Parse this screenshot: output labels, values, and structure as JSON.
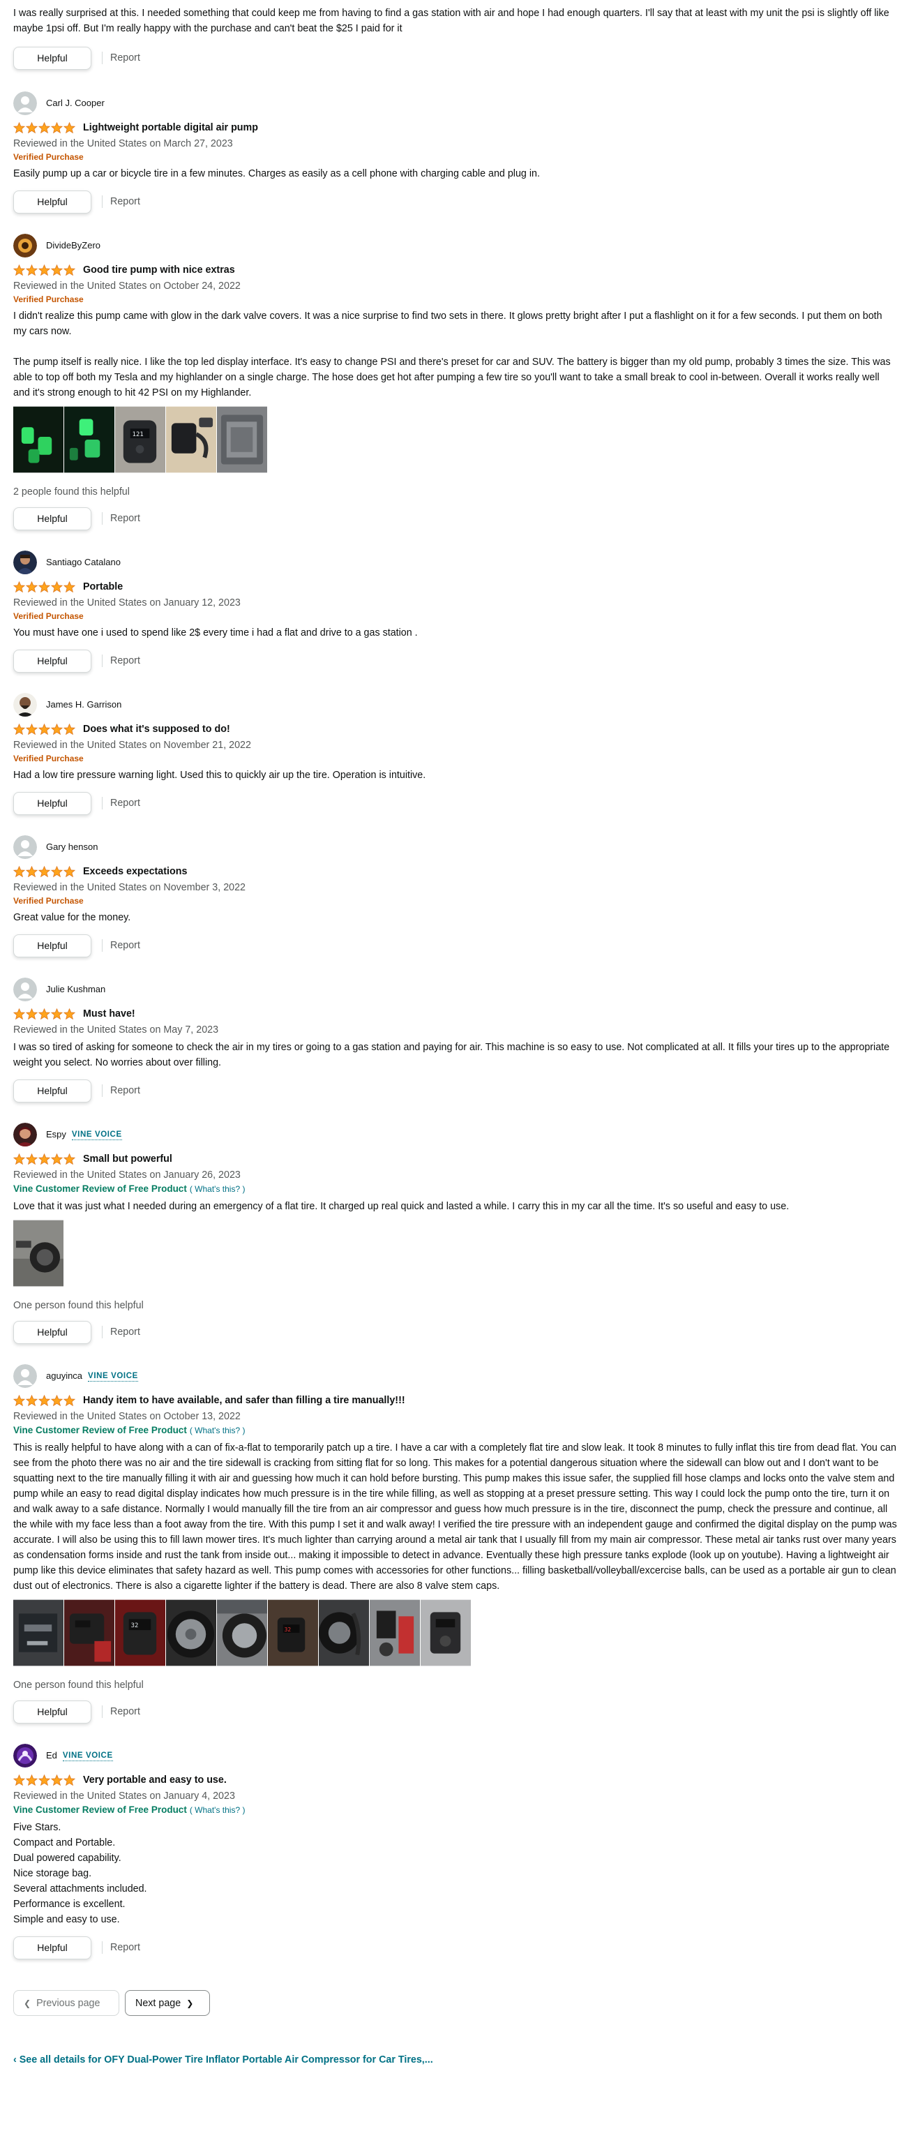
{
  "colors": {
    "star": "#ffa41c",
    "star_stroke": "#de7921",
    "verified": "#c45500",
    "vine_badge": "#067d62",
    "link": "#007185",
    "muted": "#565959"
  },
  "icons": {
    "star": "star-icon",
    "prev": "chevron-left-icon",
    "next": "chevron-right-icon",
    "see_all": "chevron-left-icon"
  },
  "labels": {
    "helpful": "Helpful",
    "report": "Report",
    "verified_purchase": "Verified Purchase",
    "vine_voice": "VINE VOICE",
    "vine_review": "Vine Customer Review of Free Product",
    "whats_this": "( What's this? )"
  },
  "top_review": {
    "text": "I was really surprised at this. I needed something that could keep me from having to find a gas station with air and hope I had enough quarters. I'll say that at least with my unit the psi is slightly off like maybe 1psi off. But I'm really happy with the purchase and can't beat the $25 I paid for it"
  },
  "reviews": [
    {
      "author": "Carl J. Cooper",
      "rating": 5,
      "title": "Lightweight portable digital air pump",
      "date": "Reviewed in the United States on March 27, 2023",
      "badge": "Verified Purchase",
      "text": "Easily pump up a car or bicycle tire in a few minutes. Charges as easily as a cell phone with charging cable and plug in."
    },
    {
      "author": "DivideByZero",
      "rating": 5,
      "title": "Good tire pump with nice extras",
      "date": "Reviewed in the United States on October 24, 2022",
      "badge": "Verified Purchase",
      "text": "I didn't realize this pump came with glow in the dark valve covers. It was a nice surprise to find two sets in there. It glows pretty bright after I put a flashlight on it for a few seconds. I put them on both my cars now.\n\nThe pump itself is really nice. I like the top led display interface. It's easy to change PSI and there's preset for car and SUV. The battery is bigger than my old pump, probably 3 times the size. This was able to top off both my Tesla and my highlander on a single charge. The hose does get hot after pumping a few tire so you'll want to take a small break to cool in-between. Overall it works really well and it's strong enough to hit 42 PSI on my Highlander.",
      "helpful_count": "2 people found this helpful"
    },
    {
      "author": "Santiago Catalano",
      "rating": 5,
      "title": "Portable",
      "date": "Reviewed in the United States on January 12, 2023",
      "badge": "Verified Purchase",
      "text": "You must have one i used to spend like 2$ every time i had a flat and drive to a gas station ."
    },
    {
      "author": "James H. Garrison",
      "rating": 5,
      "title": "Does what it's supposed to do!",
      "date": "Reviewed in the United States on November 21, 2022",
      "badge": "Verified Purchase",
      "text": "Had a low tire pressure warning light. Used this to quickly air up the tire. Operation is intuitive."
    },
    {
      "author": "Gary henson",
      "rating": 5,
      "title": "Exceeds expectations",
      "date": "Reviewed in the United States on November 3, 2022",
      "badge": "Verified Purchase",
      "text": "Great value for the money."
    },
    {
      "author": "Julie Kushman",
      "rating": 5,
      "title": "Must have!",
      "date": "Reviewed in the United States on May 7, 2023",
      "text": "I was so tired of asking for someone to check the air in my tires or going to a gas station and paying for air. This machine is so easy to use. Not complicated at all. It fills your tires up to the appropriate weight you select. No worries about over filling."
    },
    {
      "author": "Espy",
      "vine": true,
      "rating": 5,
      "title": "Small but powerful",
      "date": "Reviewed in the United States on January 26, 2023",
      "text": "Love that it was just what I needed during an emergency of a flat tire. It charged up real quick and lasted a while. I carry this in my car all the time. It's so useful and easy to use.",
      "helpful_count": "One person found this helpful"
    },
    {
      "author": "aguyinca",
      "vine": true,
      "rating": 5,
      "title": "Handy item to have available, and safer than filling a tire manually!!!",
      "date": "Reviewed in the United States on October 13, 2022",
      "text": "This is really helpful to have along with a can of fix-a-flat to temporarily patch up a tire. I have a car with a completely flat tire and slow leak. It took 8 minutes to fully inflat this tire from dead flat. You can see from the photo there was no air and the tire sidewall is cracking from sitting flat for so long. This makes for a potential dangerous situation where the sidewall can blow out and I don't want to be squatting next to the tire manually filling it with air and guessing how much it can hold before bursting. This pump makes this issue safer, the supplied fill hose clamps and locks onto the valve stem and pump while an easy to read digital display indicates how much pressure is in the tire while filling, as well as stopping at a preset pressure setting. This way I could lock the pump onto the tire, turn it on and walk away to a safe distance. Normally I would manually fill the tire from an air compressor and guess how much pressure is in the tire, disconnect the pump, check the pressure and continue, all the while with my face less than a foot away from the tire. With this pump I set it and walk away! I verified the tire pressure with an independent gauge and confirmed the digital display on the pump was accurate. I will also be using this to fill lawn mower tires. It's much lighter than carrying around a metal air tank that I usually fill from my main air compressor. These metal air tanks rust over many years as condensation forms inside and rust the tank from inside out... making it impossible to detect in advance. Eventually these high pressure tanks explode (look up on youtube). Having a lightweight air pump like this device eliminates that safety hazard as well. This pump comes with accessories for other functions... filling basketball/volleyball/excercise balls, can be used as a portable air gun to clean dust out of electronics. There is also a cigarette lighter if the battery is dead. There are also 8 valve stem caps.",
      "helpful_count": "One person found this helpful"
    },
    {
      "author": "Ed",
      "vine": true,
      "rating": 5,
      "title": "Very portable and easy to use.",
      "date": "Reviewed in the United States on January 4, 2023",
      "text": "Five Stars.\nCompact and Portable.\nDual powered capability.\nNice storage bag.\nSeveral attachments included.\nPerformance is excellent.\nSimple and easy to use."
    }
  ],
  "pagination": {
    "previous": "Previous page",
    "next": "Next page"
  },
  "see_all_details": "See all details for OFY Dual-Power Tire Inflator Portable Air Compressor for Car Tires,..."
}
